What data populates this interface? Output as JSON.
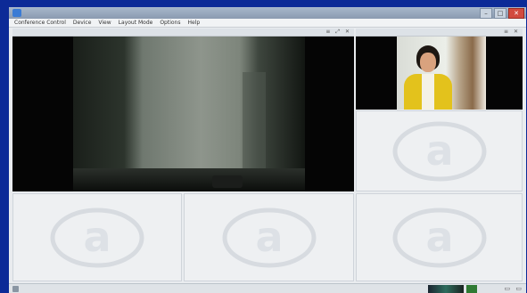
{
  "window": {
    "title": "",
    "controls": {
      "minimize": "–",
      "maximize": "□",
      "close": "✕"
    }
  },
  "menu": [
    "Conference Control",
    "Device",
    "View",
    "Layout Mode",
    "Options",
    "Help"
  ],
  "panels": {
    "main": {
      "label": "",
      "controls": "≡ ⤢ ✕"
    },
    "right": {
      "label": "",
      "controls": "≡ ✕"
    }
  },
  "placeholder_logo_char": "a",
  "statusbar": {
    "text": "",
    "buttons": "▭ ▭"
  },
  "colors": {
    "frame": "#0c2a97",
    "status_text": "#3b9a3b",
    "person_jacket": "#e3c21c"
  },
  "icons": {
    "app": "app-icon",
    "empty_tile": "at-sign-logo-watermark"
  }
}
